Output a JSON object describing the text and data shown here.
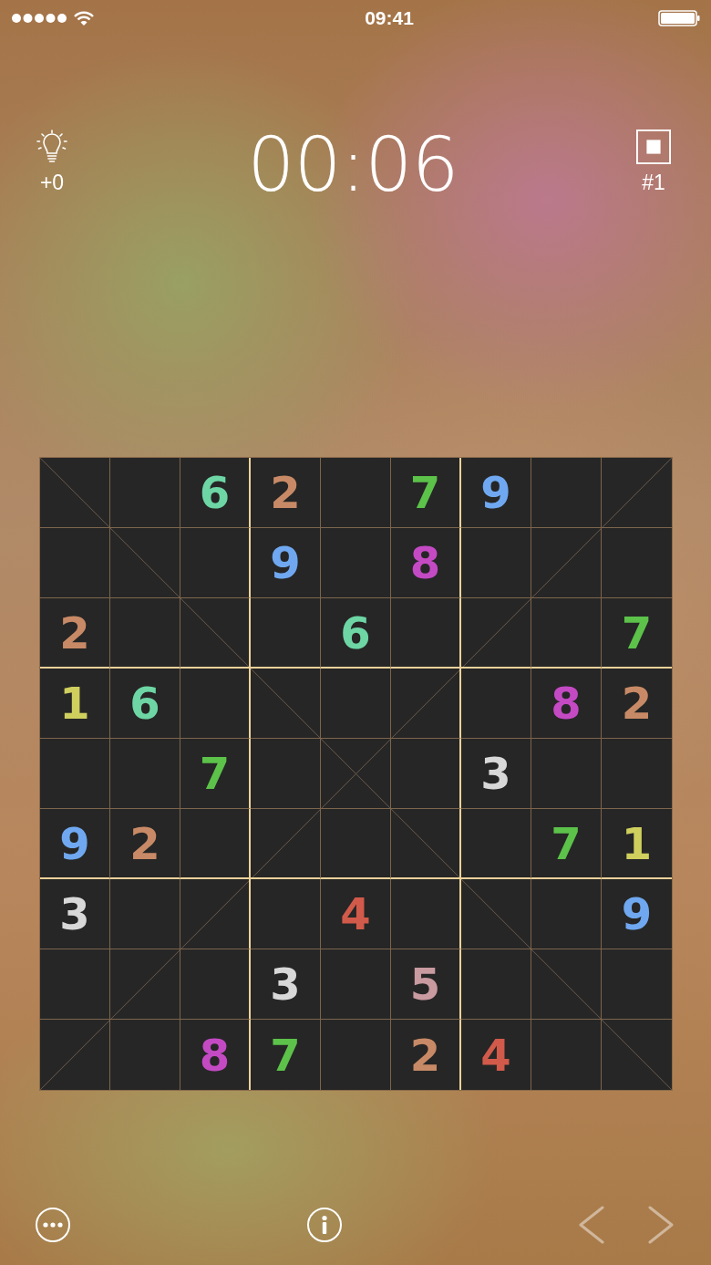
{
  "status_bar": {
    "time": "09:41"
  },
  "header": {
    "hints": "+0",
    "timer": "00:06",
    "puzzle_number": "#1"
  },
  "board": {
    "rows": [
      {
        "cells": [
          {
            "kind": "empty"
          },
          {
            "kind": "empty"
          },
          {
            "kind": "given",
            "digit": "6",
            "color": "#6dd6a4"
          },
          {
            "kind": "given",
            "digit": "2",
            "color": "#c88a66"
          },
          {
            "kind": "empty"
          },
          {
            "kind": "given",
            "digit": "7",
            "color": "#5cc24a"
          },
          {
            "kind": "given",
            "digit": "9",
            "color": "#6fa8f0"
          },
          {
            "kind": "empty"
          },
          {
            "kind": "empty"
          }
        ]
      },
      {
        "cells": [
          {
            "kind": "empty"
          },
          {
            "kind": "empty"
          },
          {
            "kind": "empty"
          },
          {
            "kind": "given",
            "digit": "9",
            "color": "#6fa8f0"
          },
          {
            "kind": "empty"
          },
          {
            "kind": "given",
            "digit": "8",
            "color": "#c44ac4"
          },
          {
            "kind": "empty"
          },
          {
            "kind": "empty"
          },
          {
            "kind": "empty"
          }
        ]
      },
      {
        "cells": [
          {
            "kind": "given",
            "digit": "2",
            "color": "#c88a66"
          },
          {
            "kind": "empty"
          },
          {
            "kind": "empty"
          },
          {
            "kind": "empty"
          },
          {
            "kind": "given",
            "digit": "6",
            "color": "#6dd6a4"
          },
          {
            "kind": "empty"
          },
          {
            "kind": "empty"
          },
          {
            "kind": "empty"
          },
          {
            "kind": "given",
            "digit": "7",
            "color": "#5cc24a"
          }
        ]
      },
      {
        "cells": [
          {
            "kind": "given",
            "digit": "1",
            "color": "#cfcf5e"
          },
          {
            "kind": "given",
            "digit": "6",
            "color": "#6dd6a4"
          },
          {
            "kind": "empty"
          },
          {
            "kind": "empty"
          },
          {
            "kind": "empty"
          },
          {
            "kind": "empty"
          },
          {
            "kind": "empty"
          },
          {
            "kind": "given",
            "digit": "8",
            "color": "#c44ac4"
          },
          {
            "kind": "given",
            "digit": "2",
            "color": "#c88a66"
          }
        ]
      },
      {
        "cells": [
          {
            "kind": "empty"
          },
          {
            "kind": "empty"
          },
          {
            "kind": "given",
            "digit": "7",
            "color": "#5cc24a"
          },
          {
            "kind": "empty"
          },
          {
            "kind": "empty"
          },
          {
            "kind": "empty"
          },
          {
            "kind": "given",
            "digit": "3",
            "color": "#d8d8d8"
          },
          {
            "kind": "empty"
          },
          {
            "kind": "empty"
          }
        ]
      },
      {
        "cells": [
          {
            "kind": "given",
            "digit": "9",
            "color": "#6fa8f0"
          },
          {
            "kind": "given",
            "digit": "2",
            "color": "#c88a66"
          },
          {
            "kind": "empty"
          },
          {
            "kind": "empty"
          },
          {
            "kind": "empty"
          },
          {
            "kind": "empty"
          },
          {
            "kind": "empty"
          },
          {
            "kind": "given",
            "digit": "7",
            "color": "#5cc24a"
          },
          {
            "kind": "given",
            "digit": "1",
            "color": "#cfcf5e"
          }
        ]
      },
      {
        "cells": [
          {
            "kind": "given",
            "digit": "3",
            "color": "#d8d8d8"
          },
          {
            "kind": "empty"
          },
          {
            "kind": "empty"
          },
          {
            "kind": "empty"
          },
          {
            "kind": "given",
            "digit": "4",
            "color": "#d25a4a"
          },
          {
            "kind": "empty"
          },
          {
            "kind": "empty"
          },
          {
            "kind": "empty"
          },
          {
            "kind": "given",
            "digit": "9",
            "color": "#6fa8f0"
          }
        ]
      },
      {
        "cells": [
          {
            "kind": "empty"
          },
          {
            "kind": "empty"
          },
          {
            "kind": "empty"
          },
          {
            "kind": "given",
            "digit": "3",
            "color": "#d8d8d8"
          },
          {
            "kind": "empty"
          },
          {
            "kind": "given",
            "digit": "5",
            "color": "#c99aa0"
          },
          {
            "kind": "empty"
          },
          {
            "kind": "empty"
          },
          {
            "kind": "empty"
          }
        ]
      },
      {
        "cells": [
          {
            "kind": "empty"
          },
          {
            "kind": "empty"
          },
          {
            "kind": "given",
            "digit": "8",
            "color": "#c44ac4"
          },
          {
            "kind": "given",
            "digit": "7",
            "color": "#5cc24a"
          },
          {
            "kind": "empty"
          },
          {
            "kind": "given",
            "digit": "2",
            "color": "#c88a66"
          },
          {
            "kind": "given",
            "digit": "4",
            "color": "#d25a4a"
          },
          {
            "kind": "empty"
          },
          {
            "kind": "empty"
          }
        ]
      }
    ]
  },
  "navigation": [
    {
      "kind": "previous",
      "disabled": true
    },
    {
      "kind": "next",
      "disabled": true
    }
  ]
}
